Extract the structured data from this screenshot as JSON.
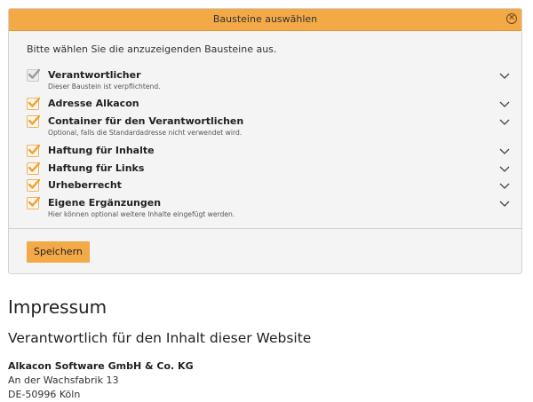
{
  "dialog": {
    "title": "Bausteine auswählen",
    "intro": "Bitte wählen Sie die anzuzeigenden Bausteine aus.",
    "save_label": "Speichern",
    "items": [
      {
        "label": "Verantwortlicher",
        "description": "Dieser Baustein ist verpflichtend.",
        "checked": true,
        "disabled": true
      },
      {
        "label": "Adresse Alkacon",
        "description": "",
        "checked": true,
        "disabled": false
      },
      {
        "label": "Container für den Verantwortlichen",
        "description": "Optional, falls die Standardadresse nicht verwendet wird.",
        "checked": true,
        "disabled": false
      },
      {
        "label": "Haftung für Inhalte",
        "description": "",
        "checked": true,
        "disabled": false
      },
      {
        "label": "Haftung für Links",
        "description": "",
        "checked": true,
        "disabled": false
      },
      {
        "label": "Urheberrecht",
        "description": "",
        "checked": true,
        "disabled": false
      },
      {
        "label": "Eigene Ergänzungen",
        "description": "Hier können optional weitere Inhalte eingefügt werden.",
        "checked": true,
        "disabled": false
      }
    ]
  },
  "page": {
    "title": "Impressum",
    "section_title": "Verantwortlich für den Inhalt dieser Website",
    "company": "Alkacon Software GmbH & Co. KG",
    "street": "An der Wachsfabrik 13",
    "city": "DE-50996 Köln"
  },
  "colors": {
    "accent": "#f4a947",
    "check": "#f0a030",
    "check_disabled": "#9a9a9a"
  },
  "icons": {
    "close": "close-icon",
    "check": "checkmark-icon",
    "expand": "chevron-down-icon"
  }
}
